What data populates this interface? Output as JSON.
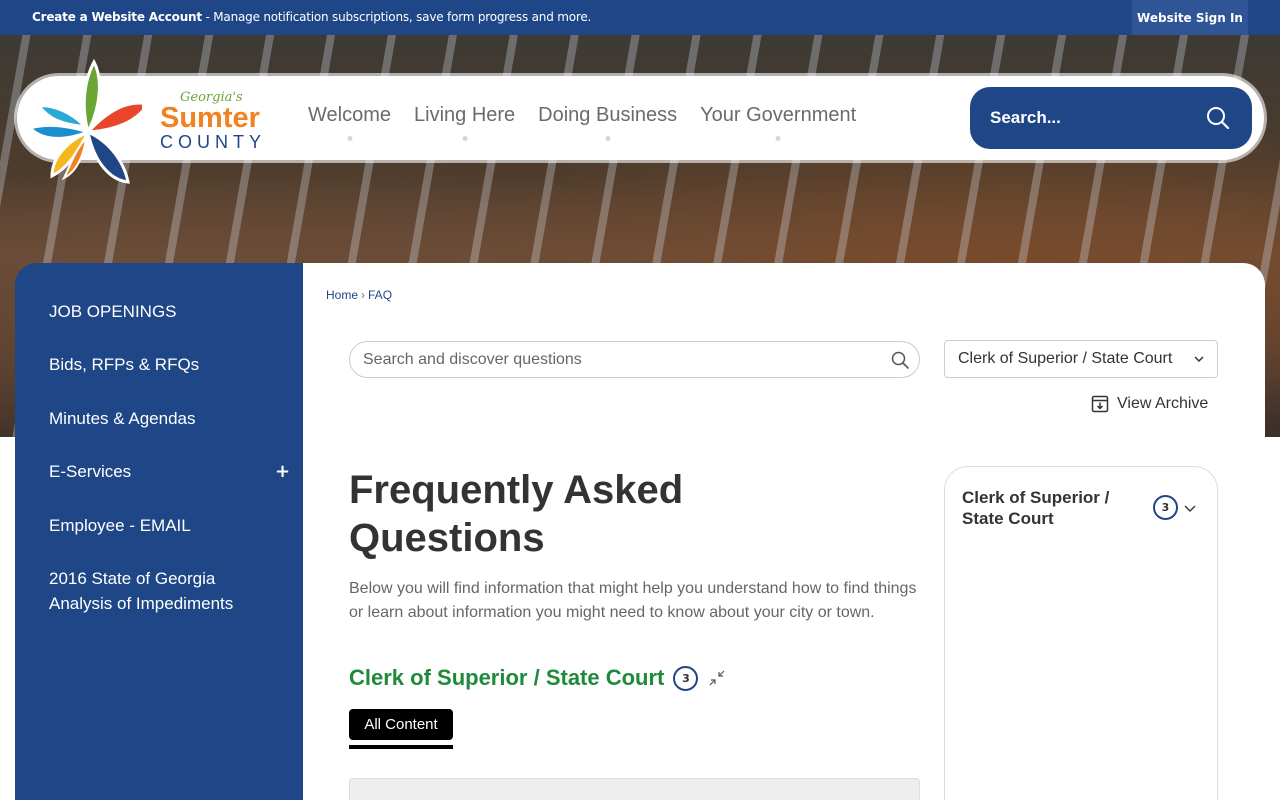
{
  "topbar": {
    "create_account": "Create a Website Account",
    "message": " - Manage notification subscriptions, save form progress and more.",
    "signin": "Website Sign In"
  },
  "logo": {
    "state": "Georgia's",
    "name": "Sumter",
    "county": "COUNTY",
    "colors": [
      "#1a8fd0",
      "#6aa535",
      "#f28220",
      "#e9452a",
      "#f5b81c",
      "#1f4686"
    ]
  },
  "nav": {
    "items": [
      "Welcome",
      "Living Here",
      "Doing Business",
      "Your Government"
    ]
  },
  "search": {
    "placeholder": "Search..."
  },
  "sidebar": {
    "items": [
      {
        "label": "JOB OPENINGS"
      },
      {
        "label": "Bids, RFPs & RFQs"
      },
      {
        "label": "Minutes & Agendas"
      },
      {
        "label": "E-Services",
        "expand": "+"
      },
      {
        "label": "Employee - EMAIL"
      },
      {
        "label": "2016 State of Georgia Analysis of Impediments"
      }
    ]
  },
  "breadcrumb": {
    "home": "Home",
    "sep": "›",
    "current": "FAQ"
  },
  "faq_search": {
    "placeholder": "Search and discover questions"
  },
  "category_select": {
    "value": "Clerk of Superior / State Court"
  },
  "archive": {
    "label": "View Archive"
  },
  "page": {
    "title": "Frequently Asked Questions",
    "description": "Below you will find information that might help you understand how to find things or learn about information you might need to know about your city or town."
  },
  "category": {
    "title": "Clerk of Superior / State Court",
    "count": "3"
  },
  "tabs": {
    "all_content": "All Content"
  },
  "panel": {
    "title": "Clerk of Superior / State Court",
    "count": "3"
  },
  "colors": {
    "brand_blue": "#1f4686",
    "category_green": "#1e8a3a"
  }
}
